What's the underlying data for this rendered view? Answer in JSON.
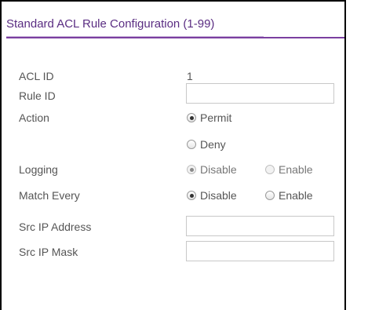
{
  "panel": {
    "title": "Standard ACL Rule Configuration (1-99)"
  },
  "fields": {
    "acl_id": {
      "label": "ACL ID",
      "value": "1"
    },
    "rule_id": {
      "label": "Rule ID",
      "value": "",
      "placeholder": ""
    },
    "action": {
      "label": "Action",
      "options": [
        "Permit",
        "Deny"
      ],
      "selected": "Permit"
    },
    "logging": {
      "label": "Logging",
      "options": [
        "Disable",
        "Enable"
      ],
      "selected": "Disable",
      "disabled": true
    },
    "match_every": {
      "label": "Match Every",
      "options": [
        "Disable",
        "Enable"
      ],
      "selected": "Disable"
    },
    "src_ip_address": {
      "label": "Src IP Address",
      "value": "",
      "placeholder": ""
    },
    "src_ip_mask": {
      "label": "Src IP Mask",
      "value": "",
      "placeholder": ""
    }
  },
  "colors": {
    "header_text": "#5a2d82",
    "header_line": "#7b3fa0",
    "frame_border": "#000000",
    "label_text": "#555555",
    "input_border": "#c8c8c8"
  }
}
